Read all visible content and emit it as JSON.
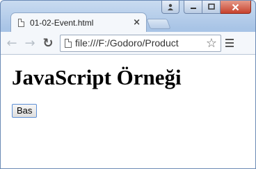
{
  "window": {
    "controls": {
      "user_icon": "user-icon",
      "minimize_icon": "minimize-icon",
      "maximize_icon": "maximize-icon",
      "close_icon": "close-icon"
    }
  },
  "tabs": [
    {
      "title": "01-02-Event.html",
      "active": true
    }
  ],
  "toolbar": {
    "url": "file:///F:/Godoro/Product",
    "back_glyph": "←",
    "forward_glyph": "→",
    "reload_glyph": "↻",
    "star_glyph": "☆"
  },
  "page": {
    "heading": "JavaScript Örneği",
    "button_label": "Bas"
  },
  "colors": {
    "frame": "#a8c4e6",
    "close_button": "#c7422d",
    "button_border": "#5c8fd6"
  }
}
